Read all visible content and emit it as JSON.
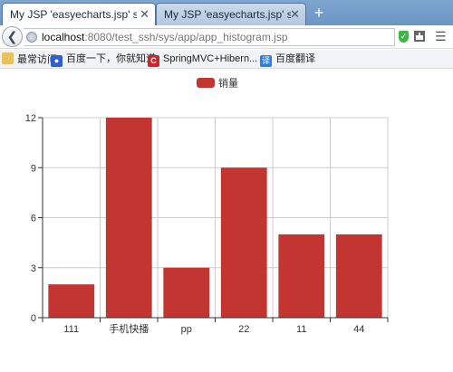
{
  "browser": {
    "tabs": [
      {
        "title": "My JSP 'easyecharts.jsp' sta...",
        "active": true
      },
      {
        "title": "My JSP 'easyecharts.jsp' sta...",
        "active": false
      }
    ],
    "new_tab_label": "+",
    "url_host": "localhost",
    "url_rest": ":8080/test_ssh/sys/app/app_histogram.jsp",
    "bookmarks": [
      {
        "label": "最常访问",
        "icon": "folder-icon"
      },
      {
        "label": "百度一下，你就知道",
        "icon": "baidu-paw-icon"
      },
      {
        "label": "SpringMVC+Hibern...",
        "icon": "c-logo-icon"
      },
      {
        "label": "百度翻译",
        "icon": "translate-icon"
      }
    ]
  },
  "colors": {
    "bar": "#c23531",
    "axis": "#333333",
    "grid": "#cccccc"
  },
  "chart_data": {
    "type": "bar",
    "legend": [
      "销量"
    ],
    "legend_position": "top-center",
    "categories": [
      "111",
      "手机快播",
      "pp",
      "22",
      "11",
      "44"
    ],
    "series": [
      {
        "name": "销量",
        "values": [
          2,
          12,
          3,
          9,
          5,
          5
        ]
      }
    ],
    "ylim": [
      0,
      12
    ],
    "yticks": [
      0,
      3,
      6,
      9,
      12
    ],
    "grid": true
  }
}
